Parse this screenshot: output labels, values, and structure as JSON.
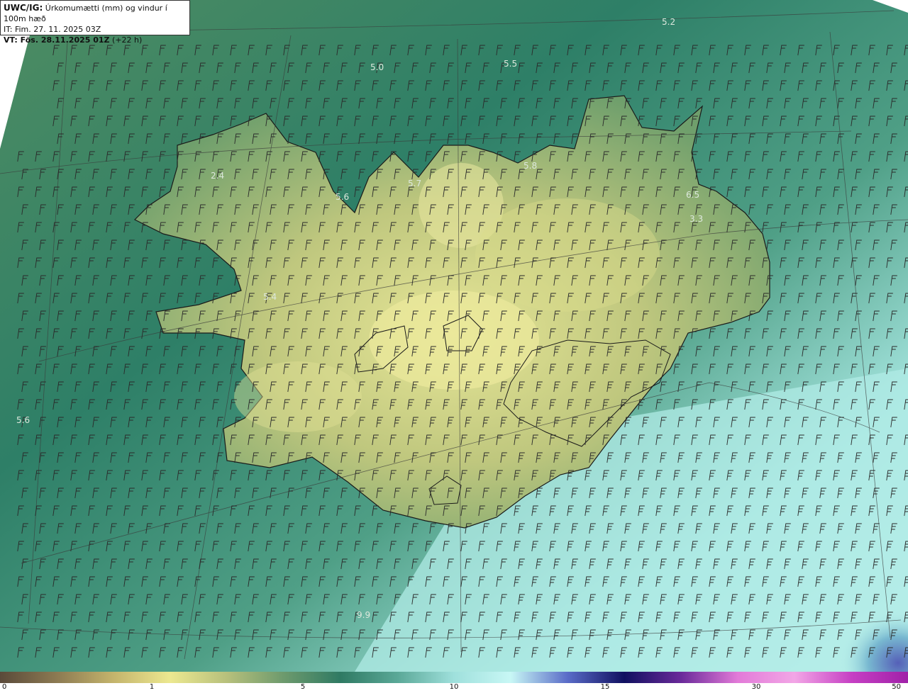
{
  "header": {
    "model_prefix": "UWC/IG:",
    "product_title": "Úrkomumætti (mm) og vindur í 100m hæð",
    "initial_time": "IT: Fim. 27. 11. 2025 03Z",
    "valid_prefix": "VT: Fös. 28.11.2025 01Z",
    "valid_suffix": "(+22 h)"
  },
  "map_values": [
    "5.2",
    "5.0",
    "5.5",
    "5.8",
    "5.7",
    "5.6",
    "2.4",
    "6.5",
    "3.3",
    "5.4",
    "5.6",
    "9.9"
  ],
  "colorbar": {
    "ticks": [
      "0",
      "1",
      "5",
      "10",
      "15",
      "30",
      "50"
    ],
    "colors": [
      "#5a4a3a",
      "#8c7a52",
      "#c4b46c",
      "#ece890",
      "#b7c07c",
      "#6d9a6d",
      "#2f7a63",
      "#5aa897",
      "#9fe0dc",
      "#c8f7f5",
      "#5a6cc8",
      "#101060",
      "#6a2a9a",
      "#e27ad8",
      "#f2a6e6",
      "#c640c4",
      "#a020a8"
    ]
  },
  "colors": {
    "sea_wind": "#2e7f67",
    "land_low": "#86a968",
    "land_high": "#e8e79a",
    "southeast_sea": "#b4efe8",
    "grid_line": "#3a3a3a"
  }
}
